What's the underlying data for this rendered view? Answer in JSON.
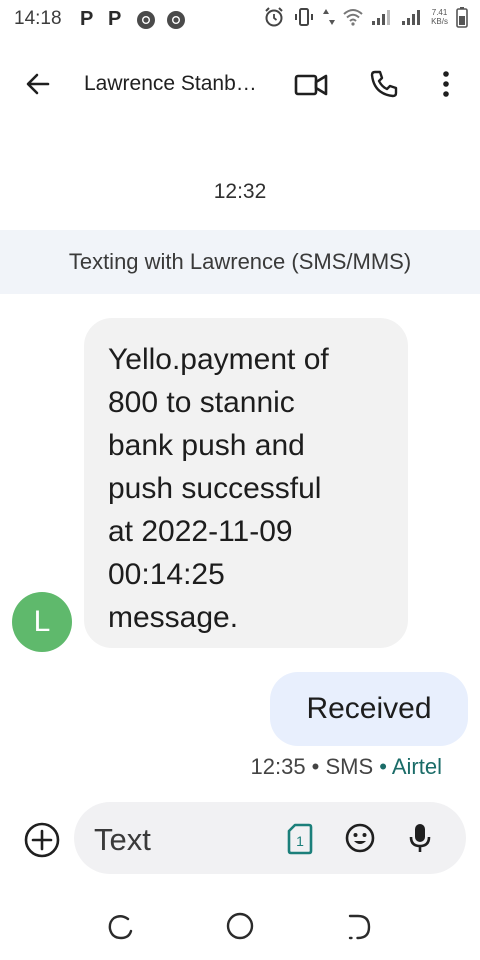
{
  "status_bar": {
    "time": "14:18",
    "notification_icons": [
      "p-icon",
      "p-icon",
      "chrome-icon",
      "chrome-icon"
    ],
    "p_glyph": "P",
    "speed_value": "7.41",
    "speed_unit": "KB/s",
    "system_icons": [
      "alarm-icon",
      "vibrate-icon",
      "data-arrows-icon",
      "wifi-icon",
      "signal-icon",
      "signal-icon",
      "battery-icon"
    ]
  },
  "app_bar": {
    "contact_name": "Lawrence Stanb…",
    "actions": [
      "video-call-icon",
      "phone-icon",
      "more-vert-icon"
    ]
  },
  "conversation": {
    "date_time": "12:32",
    "banner": "Texting with Lawrence (SMS/MMS)",
    "avatar_letter": "L",
    "avatar_color": "#5fb96c",
    "incoming_message": "Yello.payment of\n800 to stannic\nbank push and\npush successful\nat 2022-11-09\n00:14:25\nmessage.",
    "outgoing_message": "Received",
    "outgoing_status": "12:35 • SMS",
    "outgoing_carrier": " • Airtel",
    "carrier_color": "#1b6c68"
  },
  "composer": {
    "placeholder": "Text",
    "sim_number": "1",
    "icons": [
      "add-icon",
      "sim-icon",
      "emoji-icon",
      "mic-icon"
    ]
  },
  "nav_bar": {
    "icons": [
      "recents-icon",
      "home-icon",
      "back-icon"
    ]
  }
}
